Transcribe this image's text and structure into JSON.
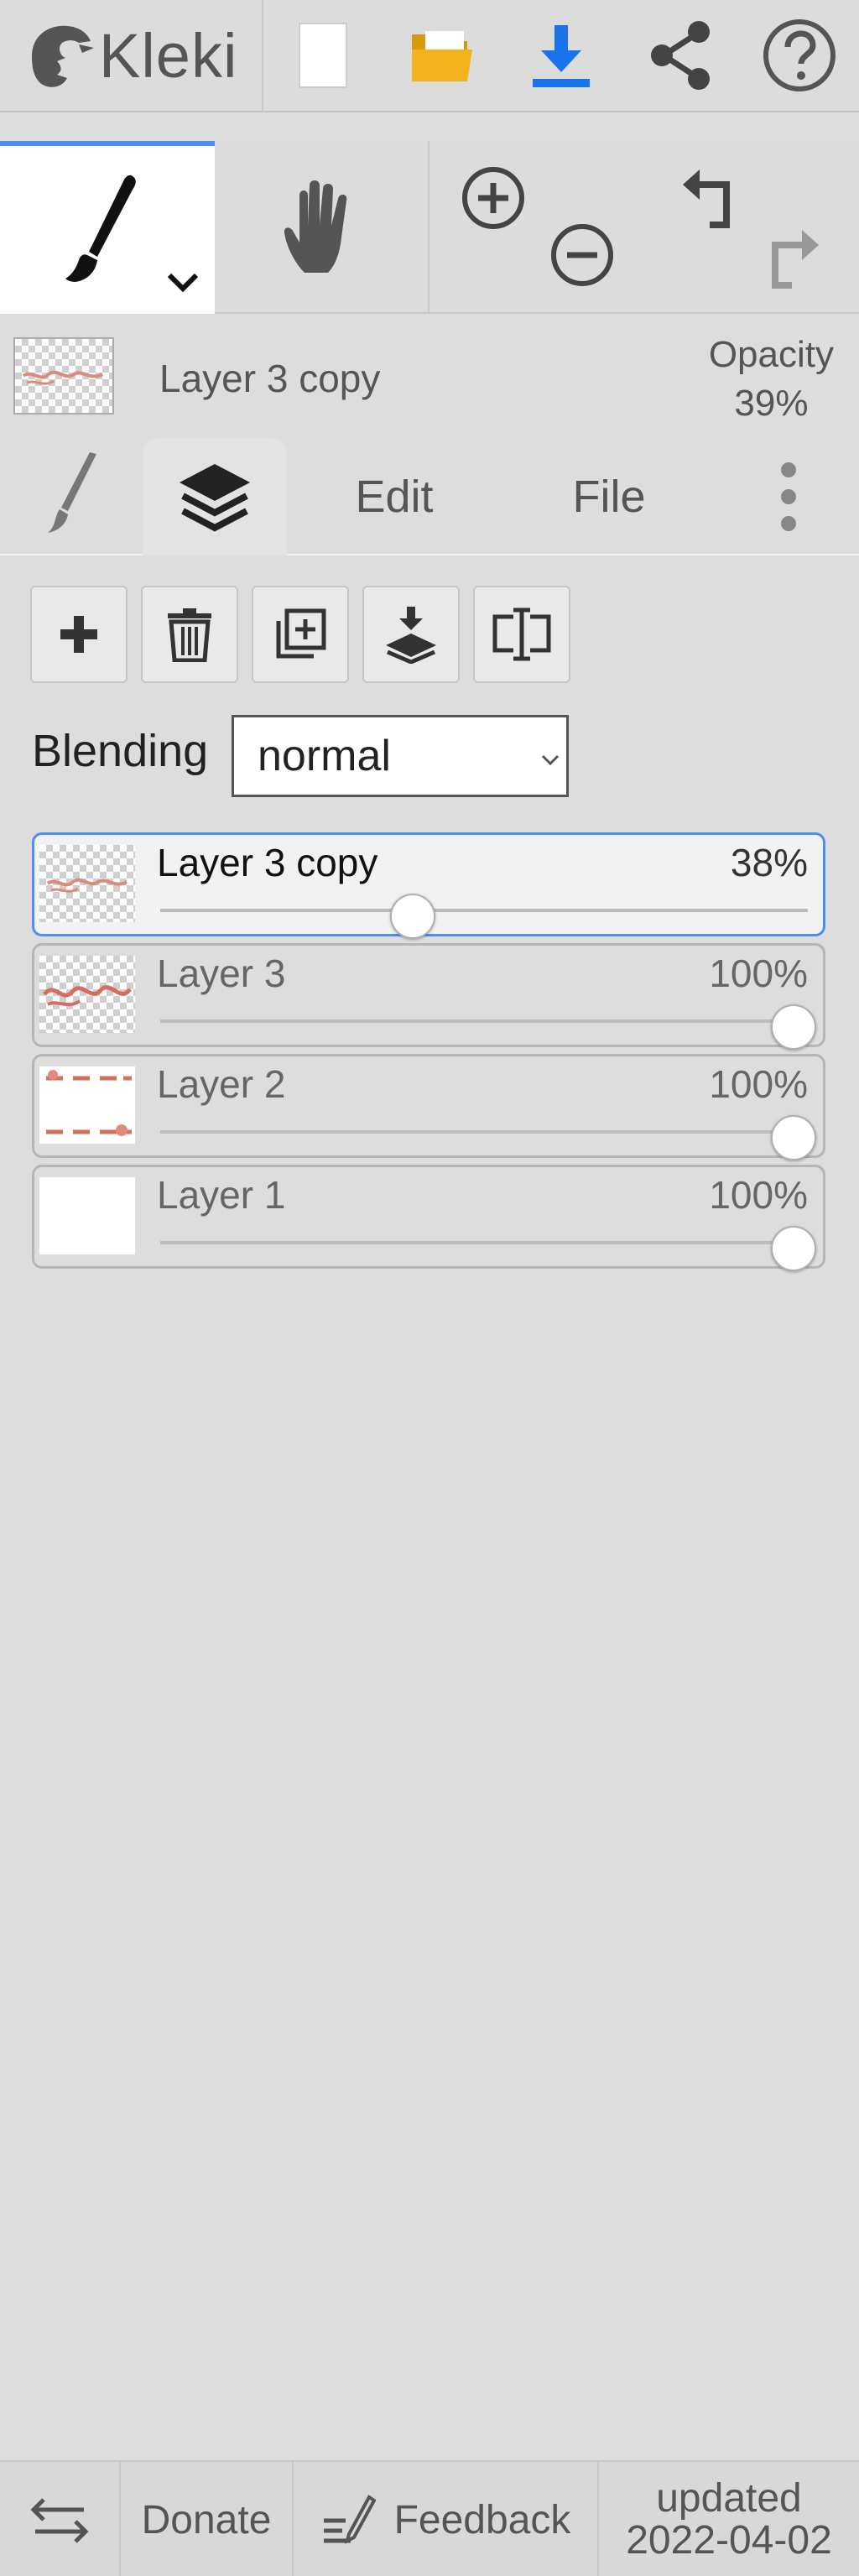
{
  "app": {
    "logo_text": "Kleki",
    "toolbar_icons": [
      "new-image-icon",
      "open-folder-icon",
      "download-icon",
      "share-icon",
      "help-icon"
    ],
    "accent_color": "#4d8df5",
    "download_color": "#1a73e8",
    "folder_color": "#f2b21b"
  },
  "tools": {
    "active_tool": "brush",
    "icons": [
      "brush-icon",
      "hand-icon",
      "zoom-in-icon",
      "zoom-out-icon",
      "undo-icon",
      "redo-icon"
    ]
  },
  "layer_info": {
    "name": "Layer 3 copy",
    "opacity_label": "Opacity",
    "opacity_value": "39%"
  },
  "tabs": [
    {
      "label": "",
      "icon": "brush-icon",
      "active": false
    },
    {
      "label": "",
      "icon": "layers-icon",
      "active": true
    },
    {
      "label": "Edit",
      "active": false
    },
    {
      "label": "File",
      "active": false
    },
    {
      "label": "",
      "icon": "more-icon",
      "active": false
    }
  ],
  "layer_actions": [
    "add-layer-icon",
    "delete-layer-icon",
    "duplicate-layer-icon",
    "merge-down-icon",
    "rename-layer-icon"
  ],
  "blending": {
    "label": "Blending",
    "value": "normal"
  },
  "layers": [
    {
      "name": "Layer 3 copy",
      "opacity": "38%",
      "opacity_fraction": 0.38,
      "selected": true
    },
    {
      "name": "Layer 3",
      "opacity": "100%",
      "opacity_fraction": 1.0,
      "selected": false
    },
    {
      "name": "Layer 2",
      "opacity": "100%",
      "opacity_fraction": 1.0,
      "selected": false
    },
    {
      "name": "Layer 1",
      "opacity": "100%",
      "opacity_fraction": 1.0,
      "selected": false
    }
  ],
  "footer": {
    "swap_icon": "swap-icon",
    "donate": "Donate",
    "feedback": "Feedback",
    "updated_label": "updated",
    "updated_date": "2022-04-02"
  }
}
